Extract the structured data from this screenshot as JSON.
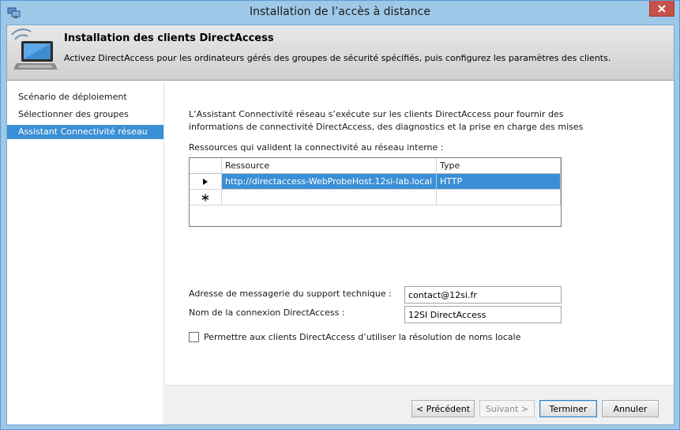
{
  "window": {
    "title": "Installation de l’accès à distance"
  },
  "header": {
    "title": "Installation des clients DirectAccess",
    "description": "Activez DirectAccess pour les ordinateurs gérés des groupes de sécurité spécifiés, puis configurez les paramètres des clients."
  },
  "sidebar": {
    "items": [
      {
        "label": "Scénario de déploiement",
        "active": false
      },
      {
        "label": "Sélectionner des groupes",
        "active": false
      },
      {
        "label": "Assistant Connectivité réseau",
        "active": true
      }
    ]
  },
  "main": {
    "intro": "L’Assistant Connectivité réseau s’exécute sur les clients DirectAccess pour fournir des informations de connectivité DirectAccess, des diagnostics et la prise en charge des mises",
    "resources_label": "Ressources qui valident la connectivité au réseau interne :",
    "grid": {
      "columns": [
        "Ressource",
        "Type"
      ],
      "rows": [
        {
          "resource": "http://directaccess-WebProbeHost.12si-lab.local",
          "type": "HTTP",
          "selected": true,
          "row_marker": "arrow"
        },
        {
          "resource": "",
          "type": "",
          "selected": false,
          "row_marker": "new-row"
        }
      ]
    },
    "support_email_label": "Adresse de messagerie du support technique :",
    "support_email_value": "contact@12si.fr",
    "connection_name_label": "Nom de la connexion DirectAccess :",
    "connection_name_value": "12SI DirectAccess",
    "local_resolution_label": "Permettre aux clients DirectAccess d’utiliser la résolution de noms locale",
    "local_resolution_checked": false
  },
  "footer": {
    "prev_label": "< Précédent",
    "next_label": "Suivant >",
    "finish_label": "Terminer",
    "cancel_label": "Annuler"
  },
  "colors": {
    "accent": "#3b8fd6",
    "frame": "#9ec8e8",
    "close_button": "#c7504b"
  }
}
